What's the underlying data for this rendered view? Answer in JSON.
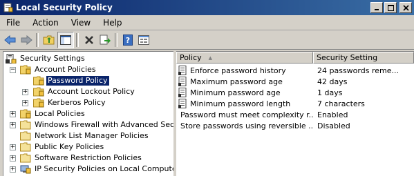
{
  "window": {
    "title": "Local Security Policy"
  },
  "menu": {
    "items": [
      "File",
      "Action",
      "View",
      "Help"
    ]
  },
  "toolbar": {
    "buttons": [
      "back-icon",
      "forward-icon",
      "up-folder-icon",
      "show-hide-tree-icon",
      "delete-icon",
      "export-icon",
      "help-icon",
      "properties-icon"
    ]
  },
  "tree": {
    "root": "Security Settings",
    "items": [
      {
        "label": "Account Policies",
        "expander": "minus"
      },
      {
        "label": "Password Policy",
        "expander": "none",
        "selected": true
      },
      {
        "label": "Account Lockout Policy",
        "expander": "plus"
      },
      {
        "label": "Kerberos Policy",
        "expander": "plus"
      },
      {
        "label": "Local Policies",
        "expander": "plus"
      },
      {
        "label": "Windows Firewall with Advanced Security",
        "expander": "plus"
      },
      {
        "label": "Network List Manager Policies",
        "expander": "none"
      },
      {
        "label": "Public Key Policies",
        "expander": "plus"
      },
      {
        "label": "Software Restriction Policies",
        "expander": "plus"
      },
      {
        "label": "IP Security Policies on Local Computer",
        "expander": "plus"
      }
    ]
  },
  "list": {
    "columns": [
      "Policy",
      "Security Setting"
    ],
    "sort_indicator": "▲",
    "rows": [
      {
        "policy": "Enforce password history",
        "setting": "24 passwords reme..."
      },
      {
        "policy": "Maximum password age",
        "setting": "42 days"
      },
      {
        "policy": "Minimum password age",
        "setting": "1 days"
      },
      {
        "policy": "Minimum password length",
        "setting": "7 characters"
      },
      {
        "policy": "Password must meet complexity r...",
        "setting": "Enabled"
      },
      {
        "policy": "Store passwords using reversible ...",
        "setting": "Disabled"
      }
    ]
  },
  "colors": {
    "title_start": "#0a246a",
    "title_end": "#3a6ea5",
    "selection": "#0a246a",
    "chrome": "#d4d0c8"
  }
}
